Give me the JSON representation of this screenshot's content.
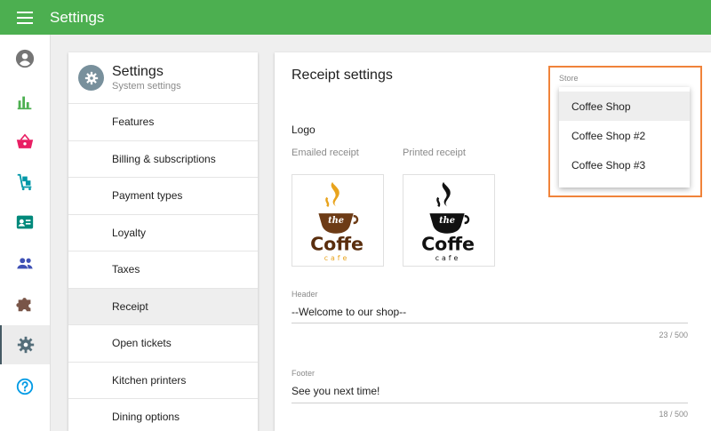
{
  "header": {
    "title": "Settings"
  },
  "nav_icons": [
    "account-icon",
    "reports-chart-icon",
    "basket-icon",
    "items-cart-icon",
    "customer-card-icon",
    "employees-icon",
    "integrations-puzzle-icon",
    "settings-gear-icon",
    "help-icon"
  ],
  "colors": {
    "topbar": "#4caf50",
    "highlight_frame": "#f0833a",
    "gear_circle": "#78909c"
  },
  "settings_panel": {
    "title": "Settings",
    "subtitle": "System settings",
    "items": [
      {
        "label": "Features"
      },
      {
        "label": "Billing & subscriptions"
      },
      {
        "label": "Payment types"
      },
      {
        "label": "Loyalty"
      },
      {
        "label": "Taxes"
      },
      {
        "label": "Receipt",
        "selected": true
      },
      {
        "label": "Open tickets"
      },
      {
        "label": "Kitchen printers"
      },
      {
        "label": "Dining options"
      }
    ]
  },
  "receipt": {
    "title": "Receipt settings",
    "logo_label": "Logo",
    "emailed_label": "Emailed receipt",
    "printed_label": "Printed receipt",
    "logo_image": {
      "top": "the",
      "main": "Coffe",
      "bottom": "cafe"
    },
    "header_field": {
      "label": "Header",
      "value": "--Welcome to our shop--",
      "counter": "23 / 500"
    },
    "footer_field": {
      "label": "Footer",
      "value": "See you next time!",
      "counter": "18 / 500"
    }
  },
  "store": {
    "label": "Store",
    "options": [
      "Coffee Shop",
      "Coffee Shop #2",
      "Coffee Shop #3"
    ],
    "highlighted": "Coffee Shop"
  }
}
